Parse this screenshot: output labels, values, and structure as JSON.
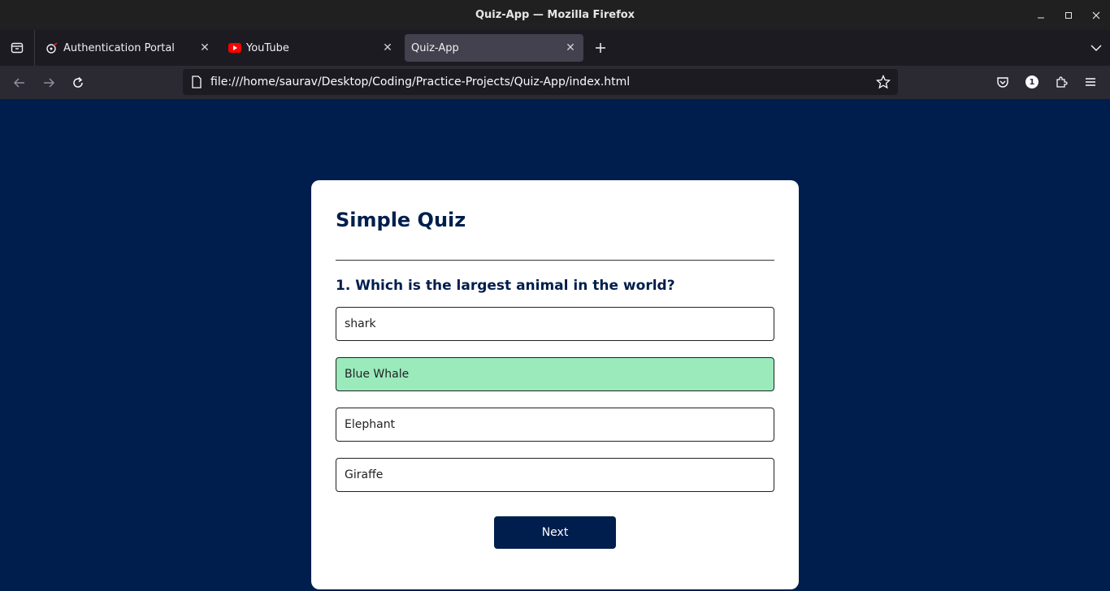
{
  "window": {
    "title": "Quiz-App — Mozilla Firefox"
  },
  "tabs": [
    {
      "label": "Authentication Portal",
      "icon": "auth-favicon-icon",
      "active": false
    },
    {
      "label": "YouTube",
      "icon": "youtube-icon",
      "active": false
    },
    {
      "label": "Quiz-App",
      "icon": "",
      "active": true
    }
  ],
  "navbar": {
    "url": "file:///home/saurav/Desktop/Coding/Practice-Projects/Quiz-App/index.html",
    "extensions_badge": "1"
  },
  "quiz": {
    "title": "Simple Quiz",
    "question": "1. Which is the largest animal in the world?",
    "answers": [
      {
        "text": "shark",
        "state": "default"
      },
      {
        "text": "Blue Whale",
        "state": "correct"
      },
      {
        "text": "Elephant",
        "state": "default"
      },
      {
        "text": "Giraffe",
        "state": "default"
      }
    ],
    "next_label": "Next"
  },
  "colors": {
    "background": "#001e4d",
    "card": "#ffffff",
    "correct": "#9aeabc",
    "button": "#001e4d"
  }
}
